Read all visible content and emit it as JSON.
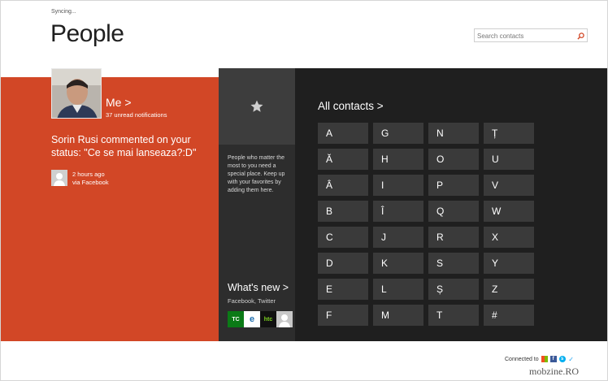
{
  "header": {
    "status": "Syncing...",
    "title": "People",
    "search_placeholder": "Search contacts"
  },
  "me": {
    "name": "Me",
    "chevron": ">",
    "notifications": "37 unread notifications",
    "activity": "Sorin Rusi commented on your status: \"Ce se mai lanseaza?:D\"",
    "activity_time": "2 hours ago",
    "activity_via": "via Facebook"
  },
  "favorites": {
    "icon": "star-icon",
    "description": "People who matter the most to you need a special place. Keep up with your favorites by adding them here."
  },
  "whats_new": {
    "label": "What's new",
    "chevron": ">",
    "sources": "Facebook, Twitter",
    "icons": [
      {
        "label": "TC",
        "bg": "#0b7a16",
        "color": "#ffffff"
      },
      {
        "label": "e",
        "bg": "#ffffff",
        "color": "#1f6fb0"
      },
      {
        "label": "htc",
        "bg": "#111111",
        "color": "#7ed321"
      },
      {
        "label": "",
        "bg": "#c8c8c8",
        "color": "#ffffff"
      }
    ]
  },
  "contacts": {
    "label": "All contacts",
    "chevron": ">",
    "letters": [
      "A",
      "Ă",
      "Â",
      "B",
      "C",
      "D",
      "E",
      "F",
      "G",
      "H",
      "I",
      "Î",
      "J",
      "K",
      "L",
      "M",
      "N",
      "O",
      "P",
      "Q",
      "R",
      "S",
      "Ș",
      "T",
      "Ț",
      "U",
      "V",
      "W",
      "X",
      "Y",
      "Z",
      "#"
    ]
  },
  "footer": {
    "connected": "Connected to",
    "watermark": "mobzine.RO"
  },
  "colors": {
    "accent": "#d24726",
    "dark": "#1f1f1f",
    "tile": "#3a3a3a"
  }
}
